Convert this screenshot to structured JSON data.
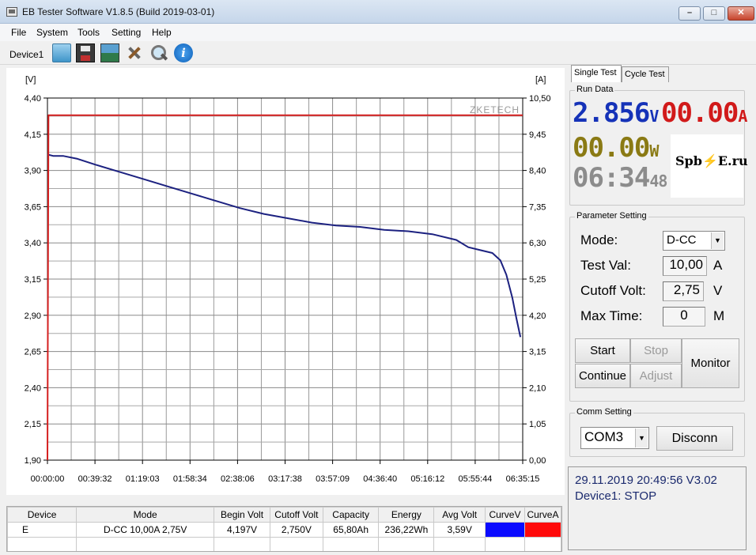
{
  "window": {
    "title": "EB Tester Software V1.8.5 (Build 2019-03-01)",
    "controls": {
      "minimize": "–",
      "maximize": "□",
      "close": "✕"
    }
  },
  "menu": [
    "File",
    "System",
    "Tools",
    "Setting",
    "Help"
  ],
  "toolbar": {
    "device_tab": "Device1",
    "icons": [
      "folder-icon",
      "save-icon",
      "image-icon",
      "tools-icon",
      "search-icon",
      "info-icon"
    ]
  },
  "chart_data": {
    "type": "line",
    "watermark": "ZKETECH",
    "y_left": {
      "unit": "[V]",
      "ticks": [
        "4,40",
        "4,15",
        "3,90",
        "3,65",
        "3,40",
        "3,15",
        "2,90",
        "2,65",
        "2,40",
        "2,15",
        "1,90"
      ],
      "range": [
        1.9,
        4.4
      ]
    },
    "y_right": {
      "unit": "[A]",
      "ticks": [
        "10,50",
        "9,45",
        "8,40",
        "7,35",
        "6,30",
        "5,25",
        "4,20",
        "3,15",
        "2,10",
        "1,05",
        "0,00"
      ],
      "range": [
        0,
        10.5
      ]
    },
    "x_ticks": [
      "00:00:00",
      "00:39:32",
      "01:19:03",
      "01:58:34",
      "02:38:06",
      "03:17:38",
      "03:57:09",
      "04:36:40",
      "05:16:12",
      "05:55:44",
      "06:35:15"
    ],
    "x_range": [
      0,
      23715
    ],
    "grid": true,
    "series": [
      {
        "color": "#1c2180",
        "axis": "left",
        "x": [
          0,
          300,
          600,
          800,
          1500,
          2400,
          3600,
          4800,
          6000,
          7200,
          8400,
          9600,
          10800,
          12000,
          13200,
          14400,
          15600,
          16800,
          18000,
          19200,
          20400,
          21000,
          21600,
          22200,
          22600,
          22900,
          23200,
          23400,
          23600
        ],
        "values": [
          4.01,
          4.0,
          4.0,
          4.0,
          3.98,
          3.94,
          3.89,
          3.84,
          3.79,
          3.74,
          3.69,
          3.64,
          3.6,
          3.57,
          3.54,
          3.52,
          3.51,
          3.49,
          3.48,
          3.46,
          3.42,
          3.37,
          3.35,
          3.33,
          3.28,
          3.18,
          3.02,
          2.88,
          2.75
        ]
      },
      {
        "color": "#d52020",
        "axis": "right",
        "x": [
          0,
          50,
          23715
        ],
        "values": [
          0,
          10.0,
          10.0
        ]
      }
    ]
  },
  "results": {
    "columns": [
      "Device",
      "Mode",
      "Begin Volt",
      "Cutoff Volt",
      "Capacity",
      "Energy",
      "Avg Volt",
      "CurveV",
      "CurveA"
    ],
    "rows": [
      {
        "device": "E",
        "mode": "D-CC  10,00A  2,75V",
        "begin_volt": "4,197V",
        "cutoff_volt": "2,750V",
        "capacity": "65,80Ah",
        "energy": "236,22Wh",
        "avg_volt": "3,59V",
        "curve_v_color": "#0a0aff",
        "curve_a_color": "#ff0a0a"
      }
    ]
  },
  "tabs": {
    "single": "Single Test",
    "cycle": "Cycle Test"
  },
  "run_data": {
    "title": "Run Data",
    "voltage": "2.856",
    "voltage_unit": "V",
    "voltage_color": "#1532b8",
    "current": "00.00",
    "current_unit": "A",
    "current_color": "#d11a1a",
    "power": "00.00",
    "power_unit": "W",
    "power_color": "#8a7a14",
    "time_main": "06:34",
    "time_sec": "48",
    "time_color": "#8c8c8c",
    "logo_left": "Spb",
    "logo_bolt": "⚡",
    "logo_right": "E.ru"
  },
  "parameters": {
    "title": "Parameter Setting",
    "mode_label": "Mode:",
    "mode_value": "D-CC",
    "test_val_label": "Test Val:",
    "test_val": "10,00",
    "test_val_unit": "A",
    "cutoff_label": "Cutoff Volt:",
    "cutoff_val": "2,75",
    "cutoff_unit": "V",
    "max_time_label": "Max Time:",
    "max_time_val": "0",
    "max_time_unit": "M",
    "buttons": {
      "start": "Start",
      "stop": "Stop",
      "continue": "Continue",
      "adjust": "Adjust",
      "monitor": "Monitor"
    }
  },
  "comm": {
    "title": "Comm Setting",
    "port": "COM3",
    "disconnect": "Disconn"
  },
  "status": {
    "line1": "29.11.2019 20:49:56  V3.02",
    "line2": "Device1: STOP"
  }
}
